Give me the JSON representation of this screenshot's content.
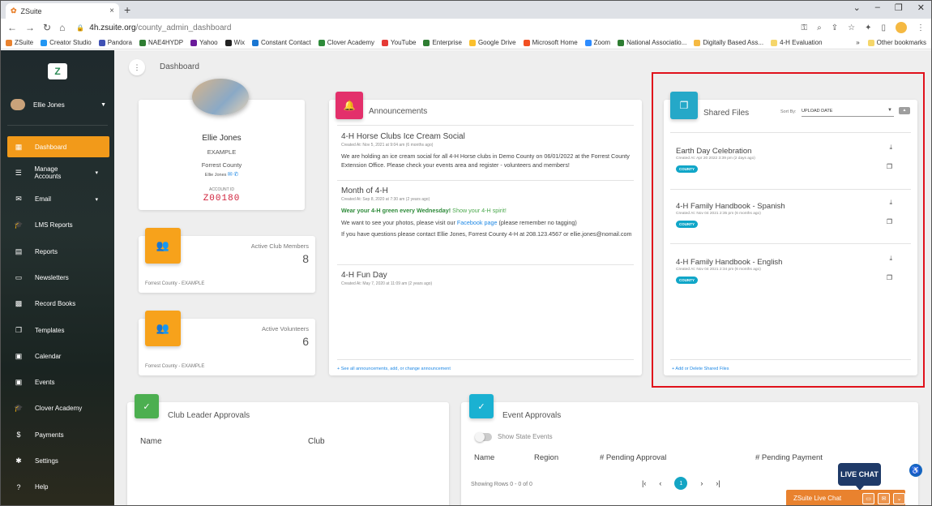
{
  "browser": {
    "tab_title": "ZSuite",
    "tab_close": "×",
    "new_tab": "+",
    "url_host": "4h.zsuite.org",
    "url_path": "/county_admin_dashboard",
    "bookmarks": [
      {
        "label": "ZSuite",
        "color": "#e9822e"
      },
      {
        "label": "Creator Studio",
        "color": "#2196f3"
      },
      {
        "label": "Pandora",
        "color": "#3f51b5"
      },
      {
        "label": "NAE4HYDP",
        "color": "#2e7d32"
      },
      {
        "label": "Yahoo",
        "color": "#6a1b9a"
      },
      {
        "label": "Wix",
        "color": "#222222"
      },
      {
        "label": "Constant Contact",
        "color": "#1976d2"
      },
      {
        "label": "Clover Academy",
        "color": "#2e8b3a"
      },
      {
        "label": "YouTube",
        "color": "#e53935"
      },
      {
        "label": "Enterprise",
        "color": "#2e7d32"
      },
      {
        "label": "Google Drive",
        "color": "#fbc02d"
      },
      {
        "label": "Microsoft Home",
        "color": "#f25022"
      },
      {
        "label": "Zoom",
        "color": "#2d8cff"
      },
      {
        "label": "National Associatio...",
        "color": "#2e7d32"
      },
      {
        "label": "Digitally Based Ass...",
        "color": "#f5b942"
      },
      {
        "label": "4-H Evaluation",
        "color": "#f5d66a"
      }
    ],
    "bookmarks_more": "»",
    "other_bookmarks": "Other bookmarks"
  },
  "sidebar": {
    "user_name": "Ellie Jones",
    "items": [
      {
        "label": "Dashboard",
        "icon": "▦",
        "icon_name": "dashboard-icon",
        "active": true
      },
      {
        "label": "Manage Accounts",
        "icon": "☰",
        "icon_name": "list-icon",
        "caret": "▾"
      },
      {
        "label": "Email",
        "icon": "✉",
        "icon_name": "mail-icon",
        "caret": "▾"
      },
      {
        "label": "LMS Reports",
        "icon": "🎓",
        "icon_name": "graduation-cap-icon"
      },
      {
        "label": "Reports",
        "icon": "▤",
        "icon_name": "clipboard-icon"
      },
      {
        "label": "Newsletters",
        "icon": "▭",
        "icon_name": "newsletter-icon"
      },
      {
        "label": "Record Books",
        "icon": "▩",
        "icon_name": "record-book-icon"
      },
      {
        "label": "Templates",
        "icon": "❐",
        "icon_name": "template-icon"
      },
      {
        "label": "Calendar",
        "icon": "▣",
        "icon_name": "calendar-icon"
      },
      {
        "label": "Events",
        "icon": "▣",
        "icon_name": "event-icon"
      },
      {
        "label": "Clover Academy",
        "icon": "🎓",
        "icon_name": "academy-icon"
      },
      {
        "label": "Payments",
        "icon": "$",
        "icon_name": "dollar-icon"
      },
      {
        "label": "Settings",
        "icon": "✱",
        "icon_name": "gear-icon"
      },
      {
        "label": "Help",
        "icon": "?",
        "icon_name": "help-icon"
      }
    ]
  },
  "main": {
    "breadcrumb": "Dashboard",
    "profile": {
      "name": "Ellie Jones",
      "org": "EXAMPLE",
      "county": "Forrest County",
      "contact_name": "Ellie Jones",
      "account_id_label": "ACCOUNT ID",
      "account_id": "Z00180"
    },
    "stats": [
      {
        "label": "Active Club Members",
        "value": "8",
        "footer": "Forrest County - EXAMPLE"
      },
      {
        "label": "Active Volunteers",
        "value": "6",
        "footer": "Forrest County - EXAMPLE"
      }
    ],
    "announcements": {
      "title": "Announcements",
      "items": [
        {
          "title": "4-H Horse Clubs Ice Cream Social",
          "meta": "Created At: Nov 5, 2021 at 9:04 am (6 months ago)",
          "body": "We are holding an ice cream social for all 4-H Horse clubs in Demo County on 06/01/2022 at the Forrest County Extension Office. Please check your events area and register - volunteers and members!"
        },
        {
          "title": "Month of 4-H",
          "meta": "Created At: Sep 8, 2020 at 7:30 am (2 years ago)",
          "highlight": "Wear your 4-H green every Wednesday!",
          "highlight2": "Show your 4-H spirit!",
          "body_pre": "We want to see your photos, please visit our",
          "link": "Facebook page",
          "body_post": "(please remember no tagging)",
          "body2": "If you have questions please contact Ellie Jones, Forrest County 4-H at 208.123.4567 or ellie.jones@nomail.com"
        },
        {
          "title": "4-H Fun Day",
          "meta": "Created At: May 7, 2020 at 11:09 am (2 years ago)"
        }
      ],
      "footer": "+ See all announcements, add, or change announcement"
    },
    "shared_files": {
      "title": "Shared Files",
      "sort_label": "Sort By:",
      "sort_value": "UPLOAD DATE",
      "items": [
        {
          "name": "Earth Day Celebration",
          "meta": "Created At: Apr 20 2022 3:39 pm (2 days ago)",
          "tag": "COUNTY"
        },
        {
          "name": "4-H Family Handbook - Spanish",
          "meta": "Created At: Nov 04 2021 2:35 pm (6 months ago)",
          "tag": "COUNTY"
        },
        {
          "name": "4-H Family Handbook - English",
          "meta": "Created At: Nov 04 2021 2:34 pm (6 months ago)",
          "tag": "COUNTY"
        }
      ],
      "footer": "+ Add or Delete Shared Files"
    },
    "club_leader_approvals": {
      "title": "Club Leader Approvals",
      "columns": [
        "Name",
        "Club"
      ]
    },
    "event_approvals": {
      "title": "Event Approvals",
      "toggle_label": "Show State Events",
      "columns": [
        "Name",
        "Region",
        "# Pending Approval",
        "# Pending Payment"
      ],
      "rows_info": "Showing Rows 0 - 0 of 0",
      "current_page": "1"
    }
  },
  "live_chat": {
    "badge": "LIVE CHAT",
    "bar_label": "ZSuite Live Chat"
  }
}
